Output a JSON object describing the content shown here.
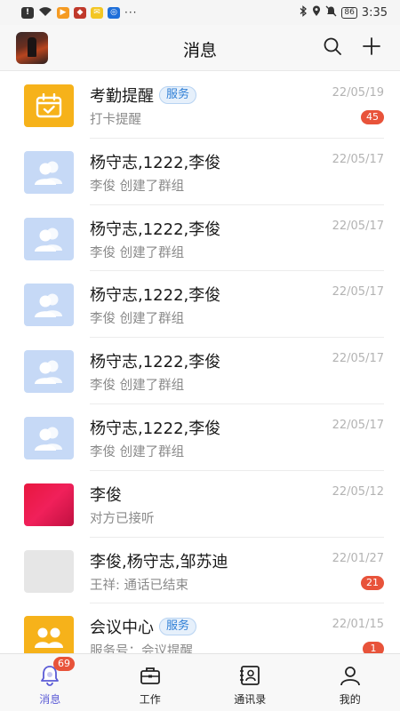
{
  "status_bar": {
    "battery": "86",
    "time": "3:35",
    "icons": [
      "alert-icon",
      "wifi-icon",
      "app-icon",
      "app-icon",
      "mail-icon",
      "app-icon",
      "more-icon"
    ]
  },
  "header": {
    "title": "消息"
  },
  "conversations": [
    {
      "name": "考勤提醒",
      "tag": "服务",
      "preview": "打卡提醒",
      "time": "22/05/19",
      "badge": "45",
      "avatar": "calendar-check-icon"
    },
    {
      "name": "杨守志,1222,李俊",
      "tag": "",
      "preview": "李俊 创建了群组",
      "time": "22/05/17",
      "badge": "",
      "avatar": "group-icon"
    },
    {
      "name": "杨守志,1222,李俊",
      "tag": "",
      "preview": "李俊 创建了群组",
      "time": "22/05/17",
      "badge": "",
      "avatar": "group-icon"
    },
    {
      "name": "杨守志,1222,李俊",
      "tag": "",
      "preview": "李俊 创建了群组",
      "time": "22/05/17",
      "badge": "",
      "avatar": "group-icon"
    },
    {
      "name": "杨守志,1222,李俊",
      "tag": "",
      "preview": "李俊 创建了群组",
      "time": "22/05/17",
      "badge": "",
      "avatar": "group-icon"
    },
    {
      "name": "杨守志,1222,李俊",
      "tag": "",
      "preview": "李俊 创建了群组",
      "time": "22/05/17",
      "badge": "",
      "avatar": "group-icon"
    },
    {
      "name": "李俊",
      "tag": "",
      "preview": "对方已接听",
      "time": "22/05/12",
      "badge": "",
      "avatar": "user-photo"
    },
    {
      "name": "李俊,杨守志,邹苏迪",
      "tag": "",
      "preview": "王祥: 通话已结束",
      "time": "22/01/27",
      "badge": "21",
      "avatar": "group-photo"
    },
    {
      "name": "会议中心",
      "tag": "服务",
      "preview": "服务号：会议提醒",
      "time": "22/01/15",
      "badge": "1",
      "avatar": "meeting-icon"
    }
  ],
  "tabs": [
    {
      "label": "消息",
      "icon": "message-bell-icon",
      "badge": "69",
      "active": true
    },
    {
      "label": "工作",
      "icon": "briefcase-icon",
      "badge": "",
      "active": false
    },
    {
      "label": "通讯录",
      "icon": "contacts-icon",
      "badge": "",
      "active": false
    },
    {
      "label": "我的",
      "icon": "person-icon",
      "badge": "",
      "active": false
    }
  ],
  "colors": {
    "accent": "#5b5bd6",
    "badge": "#e8533a",
    "service_tag": "#2f7fd6",
    "yellow_avatar": "#f6b21a",
    "group_avatar": "#c6d9f6"
  }
}
